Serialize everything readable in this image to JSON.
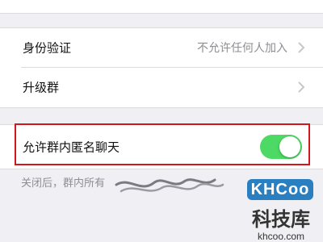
{
  "settings": {
    "identity_verification": {
      "label": "身份验证",
      "value": "不允许任何人加入"
    },
    "upgrade_group": {
      "label": "升级群"
    },
    "anonymous_chat": {
      "label": "允许群内匿名聊天",
      "enabled": true
    },
    "footnote": "关闭后，群内所有"
  },
  "watermark": {
    "logo": "KHCoo",
    "name": "科技库",
    "url": "khcoo.com"
  },
  "colors": {
    "toggle_on": "#4cd964",
    "highlight_border": "#d0181c",
    "background": "#efeff4",
    "logo_blue": "#2a7fc0"
  },
  "icons": [
    "chevron-right-icon"
  ]
}
